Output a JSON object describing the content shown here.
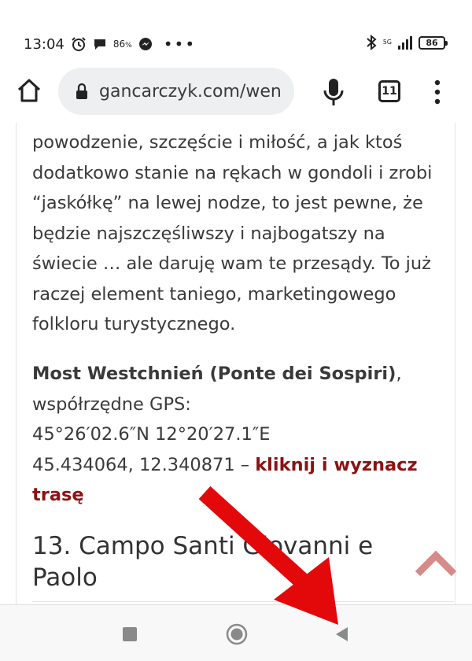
{
  "status_bar": {
    "time": "13:04",
    "notif_percent": "86",
    "notif_percent_unit": "%",
    "more_dots": "•••",
    "network": "5G",
    "battery": "86"
  },
  "toolbar": {
    "url": "gancarczyk.com/wen",
    "tab_count": "11"
  },
  "article": {
    "paragraph": "powodzenie, szczęście i miłość, a jak ktoś dodatkowo stanie na rękach w gondoli i zrobi “jaskółkę” na lewej nodze, to jest pewne, że będzie najszczęśliwszy i najbogatszy na świecie … ale daruję wam te przesądy. To już raczej element taniego, marketingowego folkloru turystycznego.",
    "location": {
      "name": "Most Westchnień (Ponte dei Sospiri)",
      "name_suffix": ",",
      "gps_label": "współrzędne GPS:",
      "dms": "45°26′02.6″N 12°20′27.1″E",
      "decimal": "45.434064, 12.340871",
      "dash": " – ",
      "route_link": "kliknij i wyznacz trasę"
    },
    "heading": "13. Campo Santi Giovanni e Paolo"
  },
  "colors": {
    "link": "#8d1212",
    "scroll_top": "#d68a8a",
    "annotation_arrow": "#e3090b"
  }
}
